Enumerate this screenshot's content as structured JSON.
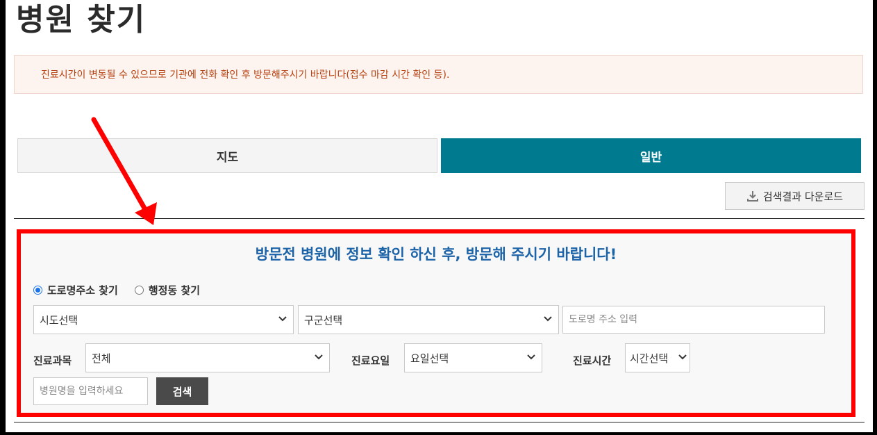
{
  "page": {
    "title": "병원 찾기"
  },
  "notice": {
    "text": "진료시간이 변동될 수 있으므로 기관에 전화 확인 후 방문해주시기 바랍니다(접수 마감 시간 확인 등)."
  },
  "tabs": [
    {
      "label": "지도",
      "active": false
    },
    {
      "label": "일반",
      "active": true
    }
  ],
  "download": {
    "label": "검색결과 다운로드",
    "icon": "download-icon"
  },
  "search": {
    "headline": "방문전 병원에 정보 확인 하신 후, 방문해 주시기 바랍니다!",
    "radios": [
      {
        "label": "도로명주소 찾기",
        "checked": true
      },
      {
        "label": "행정동 찾기",
        "checked": false
      }
    ],
    "sido_select": "시도선택",
    "gugun_select": "구군선택",
    "road_placeholder": "도로명 주소 입력",
    "dept_label": "진료과목",
    "dept_select": "전체",
    "day_label": "진료요일",
    "day_select": "요일선택",
    "time_label": "진료시간",
    "time_select": "시간선택",
    "name_placeholder": "병원명을 입력하세요",
    "search_button": "검색"
  },
  "colors": {
    "accent_tab": "#007a8f",
    "highlight_border": "#ff0000",
    "headline": "#1c63a8",
    "notice_text": "#b5400f"
  }
}
